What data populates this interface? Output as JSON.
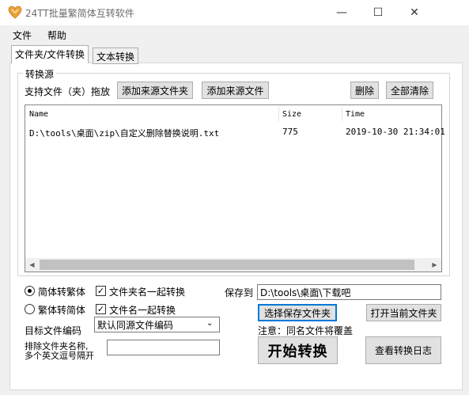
{
  "window": {
    "title": "24TT批量繁简体互转软件",
    "min_glyph": "—",
    "max_glyph": "☐",
    "close_glyph": "✕",
    "logo_color": "#e8a33a"
  },
  "menu": [
    {
      "label": "文件"
    },
    {
      "label": "帮助"
    }
  ],
  "tabs": [
    {
      "label": "文件夹/文件转换",
      "active": true
    },
    {
      "label": "文本转换",
      "active": false
    }
  ],
  "source_group": {
    "title": "转换源",
    "support_label": "支持文件（夹）拖放",
    "add_folder_button": "添加来源文件夹",
    "add_file_button": "添加来源文件",
    "delete_button": "删除",
    "clear_all_button": "全部清除"
  },
  "file_list": {
    "columns": [
      "Name",
      "Size",
      "Time"
    ],
    "rows": [
      {
        "name": "D:\\tools\\桌面\\zip\\自定义删除替换说明.txt",
        "size": "775",
        "time": "2019-10-30 21:34:01"
      }
    ]
  },
  "options": {
    "radio_s2t": "简体转繁体",
    "radio_t2s": "繁体转简体",
    "radio_selected": "s2t",
    "check_folder_name": "文件夹名一起转换",
    "check_file_name": "文件名一起转换",
    "check_folder_name_checked": true,
    "check_file_name_checked": true,
    "check_glyph": "✓",
    "encoding_label": "目标文件编码",
    "encoding_value": "默认同源文件编码",
    "exclude_label_1": "排除文件夹名称,",
    "exclude_label_2": "多个英文逗号隔开",
    "exclude_value": ""
  },
  "output": {
    "save_to_label": "保存到",
    "save_path": "D:\\tools\\桌面\\下载吧",
    "choose_folder_button": "选择保存文件夹",
    "open_folder_button": "打开当前文件夹",
    "note": "注意：同名文件将覆盖",
    "start_button": "开始转换",
    "log_button": "查看转换日志"
  }
}
